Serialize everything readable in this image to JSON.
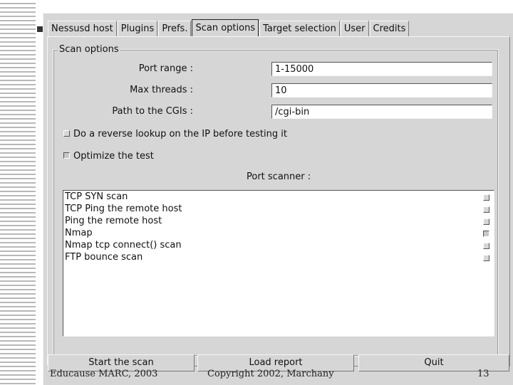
{
  "tabs": [
    {
      "label": "Nessusd host"
    },
    {
      "label": "Plugins"
    },
    {
      "label": "Prefs."
    },
    {
      "label": "Scan options",
      "active": true
    },
    {
      "label": "Target selection"
    },
    {
      "label": "User"
    },
    {
      "label": "Credits"
    }
  ],
  "scan_options": {
    "group_title": "Scan options",
    "port_range": {
      "label": "Port range :",
      "value": "1-15000"
    },
    "max_threads": {
      "label": "Max threads :",
      "value": "10"
    },
    "cgi_path": {
      "label": "Path to the CGIs :",
      "value": "/cgi-bin"
    },
    "reverse_lookup": {
      "label": "Do a reverse lookup on the IP before testing it",
      "checked": false
    },
    "optimize": {
      "label": "Optimize the test",
      "checked": true
    },
    "port_scanner_label": "Port scanner :",
    "scanners": [
      {
        "label": "TCP SYN scan",
        "checked": false
      },
      {
        "label": "TCP Ping the remote host",
        "checked": false
      },
      {
        "label": "Ping the remote host",
        "checked": false
      },
      {
        "label": "Nmap",
        "checked": true
      },
      {
        "label": "Nmap tcp connect() scan",
        "checked": false
      },
      {
        "label": "FTP bounce scan",
        "checked": false
      }
    ]
  },
  "buttons": {
    "start": "Start the scan",
    "load": "Load report",
    "quit": "Quit"
  },
  "footer": {
    "left": "Educause MARC, 2003",
    "center": "Copyright 2002, Marchany",
    "page": "13"
  }
}
